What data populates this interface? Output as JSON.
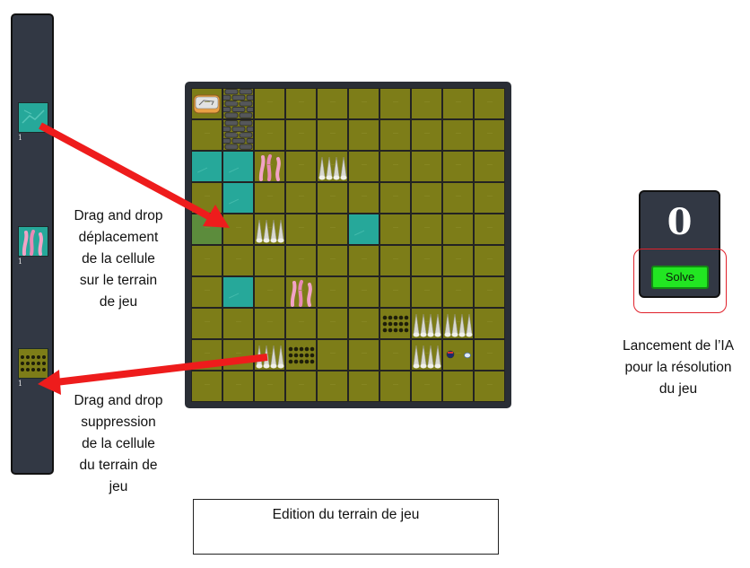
{
  "palette": {
    "items": [
      {
        "name": "water",
        "count": "1"
      },
      {
        "name": "coral",
        "count": "1"
      },
      {
        "name": "mud-holes",
        "count": "1"
      }
    ]
  },
  "board": {
    "rows": 10,
    "cols": 10,
    "cells": [
      {
        "r": 0,
        "c": 0,
        "type": "player-bed"
      },
      {
        "r": 0,
        "c": 1,
        "type": "stone-wall"
      },
      {
        "r": 1,
        "c": 1,
        "type": "stone-wall"
      },
      {
        "r": 2,
        "c": 0,
        "type": "water"
      },
      {
        "r": 2,
        "c": 1,
        "type": "water"
      },
      {
        "r": 2,
        "c": 2,
        "type": "coral"
      },
      {
        "r": 2,
        "c": 4,
        "type": "spikes"
      },
      {
        "r": 3,
        "c": 1,
        "type": "water"
      },
      {
        "r": 4,
        "c": 0,
        "type": "ghost-drop"
      },
      {
        "r": 4,
        "c": 2,
        "type": "spikes"
      },
      {
        "r": 4,
        "c": 5,
        "type": "water"
      },
      {
        "r": 6,
        "c": 1,
        "type": "water"
      },
      {
        "r": 6,
        "c": 3,
        "type": "coral"
      },
      {
        "r": 7,
        "c": 6,
        "type": "mud-holes"
      },
      {
        "r": 7,
        "c": 7,
        "type": "spikes"
      },
      {
        "r": 7,
        "c": 8,
        "type": "spikes"
      },
      {
        "r": 8,
        "c": 2,
        "type": "spikes"
      },
      {
        "r": 8,
        "c": 3,
        "type": "mud-holes"
      },
      {
        "r": 8,
        "c": 7,
        "type": "spikes"
      },
      {
        "r": 8,
        "c": 8,
        "type": "items"
      }
    ]
  },
  "score": {
    "value": "0",
    "solve_label": "Solve"
  },
  "notes": {
    "drag_move": [
      "Drag and drop",
      "déplacement",
      "de la cellule",
      "sur le terrain",
      "de jeu"
    ],
    "drag_delete": [
      "Drag and drop",
      "suppression",
      "de la cellule",
      "du terrain de",
      "jeu"
    ],
    "ai_launch": [
      "Lancement de l’IA",
      "pour la résolution",
      "du jeu"
    ],
    "caption": "Edition du terrain de jeu"
  },
  "colors": {
    "ground": "#7d7d18",
    "water": "#26a89a",
    "panel": "#323844",
    "solve_button": "#22e622",
    "annotation_arrow": "#ee1c1c",
    "highlight": "#e0202a"
  }
}
